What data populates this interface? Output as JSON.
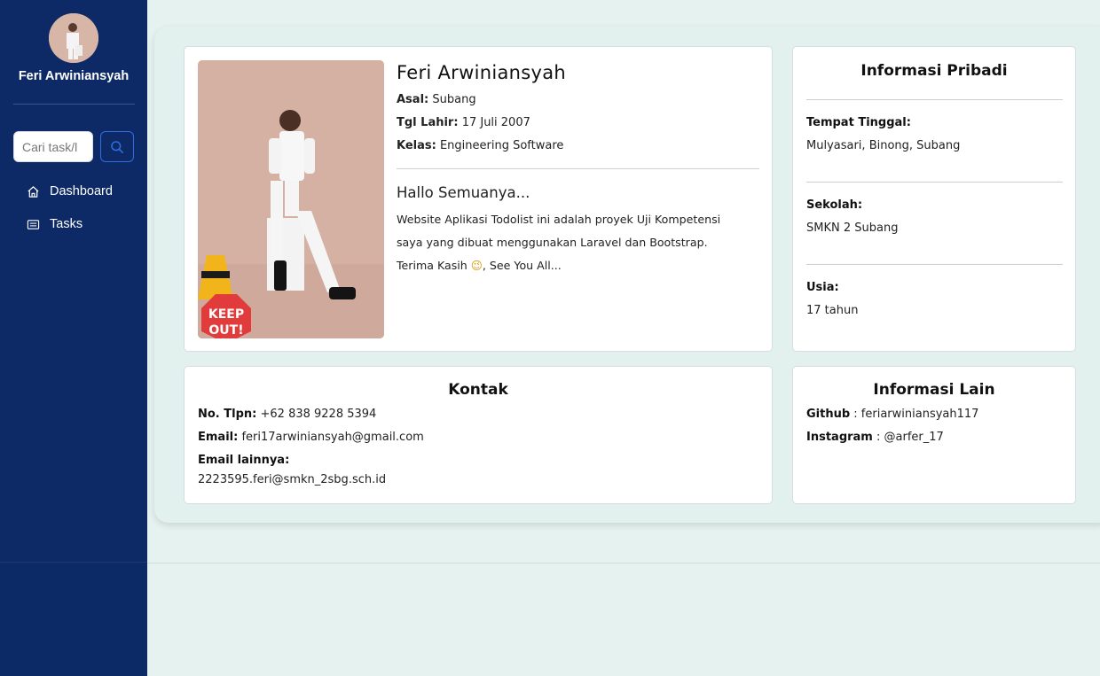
{
  "sidebar": {
    "user_name": "Feri Arwiniansyah",
    "search": {
      "placeholder": "Cari task/l",
      "value": ""
    },
    "nav": [
      {
        "label": "Dashboard",
        "icon": "home-icon"
      },
      {
        "label": "Tasks",
        "icon": "list-card-icon"
      }
    ]
  },
  "profile": {
    "name": "Feri Arwiniansyah",
    "fields": [
      {
        "label": "Asal:",
        "value": "Subang"
      },
      {
        "label": "Tgl Lahir:",
        "value": "17 Juli 2007"
      },
      {
        "label": "Kelas:",
        "value": "Engineering Software"
      }
    ],
    "greeting": "Hallo Semuanya...",
    "description_1": "Website Aplikasi Todolist ini adalah proyek Uji Kompetensi",
    "description_2": "saya yang dibuat menggunakan Laravel dan Bootstrap.",
    "description_3a": "Terima Kasih",
    "emoji": "😉",
    "description_3b": ", See You All..."
  },
  "personal_info": {
    "title": "Informasi Pribadi",
    "items": [
      {
        "label": "Tempat Tinggal:",
        "value": "Mulyasari, Binong, Subang"
      },
      {
        "label": "Sekolah:",
        "value": "SMKN 2 Subang"
      },
      {
        "label": "Usia:",
        "value": "17 tahun"
      }
    ]
  },
  "contact": {
    "title": "Kontak",
    "phone_label": "No. Tlpn:",
    "phone": "+62 838 9228 5394",
    "email_label": "Email:",
    "email": "feri17arwiniansyah@gmail.com",
    "email2_label": "Email lainnya:",
    "email2": "2223595.feri@smkn_2sbg.sch.id"
  },
  "other_info": {
    "title": "Informasi Lain",
    "github_label": "Github",
    "github": ": feriarwiniansyah117",
    "instagram_label": "Instagram",
    "instagram": ": @arfer_17"
  },
  "photo_sign": {
    "line1": "KEEP",
    "line2": "OUT!"
  },
  "colors": {
    "sidebar": "#0d2a66",
    "background": "#e6f2ef",
    "accent": "#2f6de0"
  }
}
